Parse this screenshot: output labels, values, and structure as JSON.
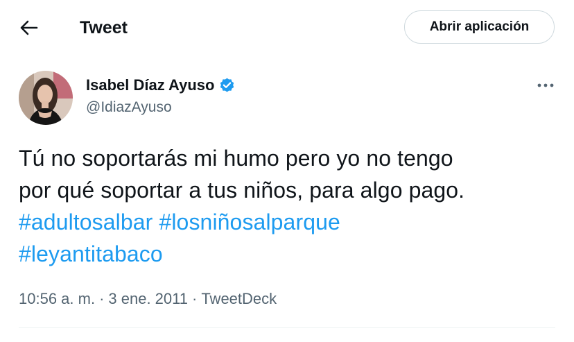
{
  "header": {
    "title": "Tweet",
    "back_icon": "arrow-left-icon",
    "open_app_label": "Abrir aplicación"
  },
  "author": {
    "name": "Isabel Díaz Ayuso",
    "handle": "@IdiazAyuso",
    "verified": true,
    "verified_icon": "verified-badge-icon",
    "more_icon": "more-horizontal-icon"
  },
  "tweet": {
    "line1": "Tú no soportarás mi humo pero yo no tengo",
    "line2": "por qué soportar a tus niños, para algo pago.",
    "hashtags": [
      "#adultosalbar",
      "#losniñosalparque",
      "#leyantitabaco"
    ]
  },
  "meta": {
    "time": "10:56 a. m.",
    "separator": "·",
    "date": "3 ene. 2011",
    "source": "TweetDeck"
  },
  "colors": {
    "accent": "#1d9bf0",
    "text": "#0f1419",
    "secondary": "#536471",
    "border": "#cfd9de"
  }
}
